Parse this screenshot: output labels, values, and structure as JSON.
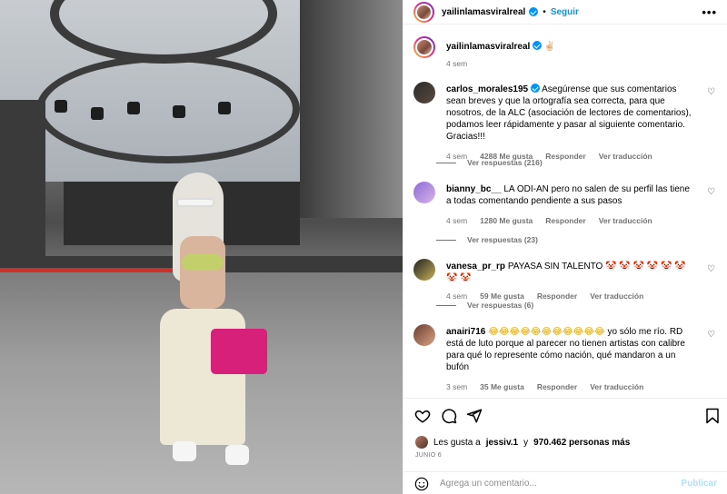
{
  "post": {
    "author": "yailinlamasviralreal",
    "follow_label": "Seguir",
    "more_label": "•••",
    "caption_emoji": "✌🏻",
    "time_ago": "4 sem"
  },
  "comments": [
    {
      "user": "carlos_morales195",
      "verified": true,
      "text": "Asegúrense que sus comentarios sean breves y que la ortografía sea correcta, para que nosotros, de la ALC (asociación de lectores de comentarios), podamos leer rápidamente y pasar al siguiente comentario. Gracias!!!",
      "time": "4 sem",
      "likes": "4288 Me gusta",
      "reply_label": "Responder",
      "translate_label": "Ver traducción",
      "replies_label": "Ver respuestas (216)"
    },
    {
      "user": "bianny_bc__",
      "verified": false,
      "text": "LA ODI-AN pero no salen de su perfil las tiene a todas comentando pendiente a sus pasos",
      "time": "4 sem",
      "likes": "1280 Me gusta",
      "reply_label": "Responder",
      "translate_label": "Ver traducción",
      "replies_label": "Ver respuestas (23)"
    },
    {
      "user": "vanesa_pr_rp",
      "verified": false,
      "text": "PAYASA SIN TALENTO",
      "emoji": "🤡 🤡 🤡 🤡 🤡 🤡 🤡 🤡",
      "time": "4 sem",
      "likes": "59 Me gusta",
      "reply_label": "Responder",
      "translate_label": "Ver traducción",
      "replies_label": "Ver respuestas (6)"
    },
    {
      "user": "anairi716",
      "verified": false,
      "emoji": "😂😂😂😂😂😂😂😂😂😂😂",
      "text": "yo sólo me río. RD está de luto porque al parecer no tienen artistas con calibre para qué lo represente cómo nación, qué mandaron a un bufón",
      "time": "3 sem",
      "likes": "35 Me gusta",
      "reply_label": "Responder",
      "translate_label": "Ver traducción"
    }
  ],
  "likes": {
    "prefix": "Les gusta a",
    "user": "jessiv.1",
    "middle": "y",
    "count": "970.462 personas más"
  },
  "date": "JUNIO 6",
  "comment_box": {
    "placeholder": "Agrega un comentario...",
    "post_label": "Publicar"
  },
  "colors": {
    "accent": "#0095f6",
    "muted": "#737373",
    "bag": "#d6207a"
  },
  "icons": [
    "heart-icon",
    "comment-icon",
    "share-icon",
    "bookmark-icon",
    "emoji-icon",
    "verified-icon",
    "more-icon"
  ]
}
